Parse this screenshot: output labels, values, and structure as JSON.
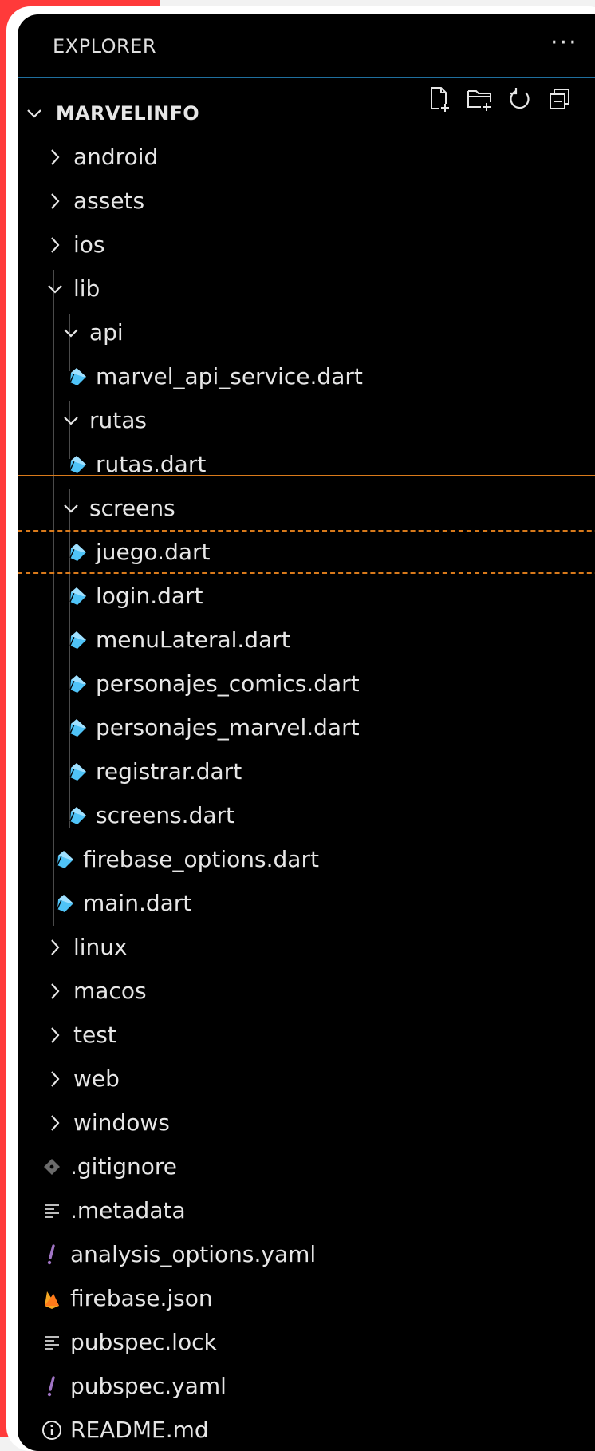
{
  "explorer": {
    "title": "EXPLORER",
    "more_label": "···",
    "root_label": "MARVELINFO",
    "toolbar": {
      "new_file": "new-file-icon",
      "new_folder": "new-folder-icon",
      "refresh": "refresh-icon",
      "collapse": "collapse-all-icon"
    }
  },
  "tree": [
    {
      "label": "android",
      "type": "folder",
      "expanded": false,
      "depth": 1
    },
    {
      "label": "assets",
      "type": "folder",
      "expanded": false,
      "depth": 1
    },
    {
      "label": "ios",
      "type": "folder",
      "expanded": false,
      "depth": 1
    },
    {
      "label": "lib",
      "type": "folder",
      "expanded": true,
      "depth": 1
    },
    {
      "label": "api",
      "type": "folder",
      "expanded": true,
      "depth": 2
    },
    {
      "label": "marvel_api_service.dart",
      "type": "dart",
      "depth": 3
    },
    {
      "label": "rutas",
      "type": "folder",
      "expanded": true,
      "depth": 2
    },
    {
      "label": "rutas.dart",
      "type": "dart",
      "depth": 3
    },
    {
      "label": "screens",
      "type": "folder",
      "expanded": true,
      "depth": 2
    },
    {
      "label": "juego.dart",
      "type": "dart",
      "depth": 3,
      "selected": true
    },
    {
      "label": "login.dart",
      "type": "dart",
      "depth": 3
    },
    {
      "label": "menuLateral.dart",
      "type": "dart",
      "depth": 3
    },
    {
      "label": "personajes_comics.dart",
      "type": "dart",
      "depth": 3
    },
    {
      "label": "personajes_marvel.dart",
      "type": "dart",
      "depth": 3
    },
    {
      "label": "registrar.dart",
      "type": "dart",
      "depth": 3
    },
    {
      "label": "screens.dart",
      "type": "dart",
      "depth": 3
    },
    {
      "label": "firebase_options.dart",
      "type": "dart",
      "depth": 2
    },
    {
      "label": "main.dart",
      "type": "dart",
      "depth": 2
    },
    {
      "label": "linux",
      "type": "folder",
      "expanded": false,
      "depth": 1
    },
    {
      "label": "macos",
      "type": "folder",
      "expanded": false,
      "depth": 1
    },
    {
      "label": "test",
      "type": "folder",
      "expanded": false,
      "depth": 1
    },
    {
      "label": "web",
      "type": "folder",
      "expanded": false,
      "depth": 1
    },
    {
      "label": "windows",
      "type": "folder",
      "expanded": false,
      "depth": 1
    },
    {
      "label": ".gitignore",
      "type": "git",
      "depth": 1
    },
    {
      "label": ".metadata",
      "type": "lines",
      "depth": 1
    },
    {
      "label": "analysis_options.yaml",
      "type": "yaml",
      "depth": 1
    },
    {
      "label": "firebase.json",
      "type": "firebase",
      "depth": 1
    },
    {
      "label": "pubspec.lock",
      "type": "lines",
      "depth": 1
    },
    {
      "label": "pubspec.yaml",
      "type": "yaml",
      "depth": 1
    },
    {
      "label": "README.md",
      "type": "info",
      "depth": 1
    }
  ],
  "colors": {
    "background": "#000000",
    "text": "#e6e6e6",
    "dart_icon": "#4fc3f7",
    "yaml_icon": "#a074c4",
    "firebase_icon": "#f5a623",
    "git_icon": "#6a6a6a",
    "selection_border": "#d97a1b",
    "header_border": "#1f6f9e"
  }
}
